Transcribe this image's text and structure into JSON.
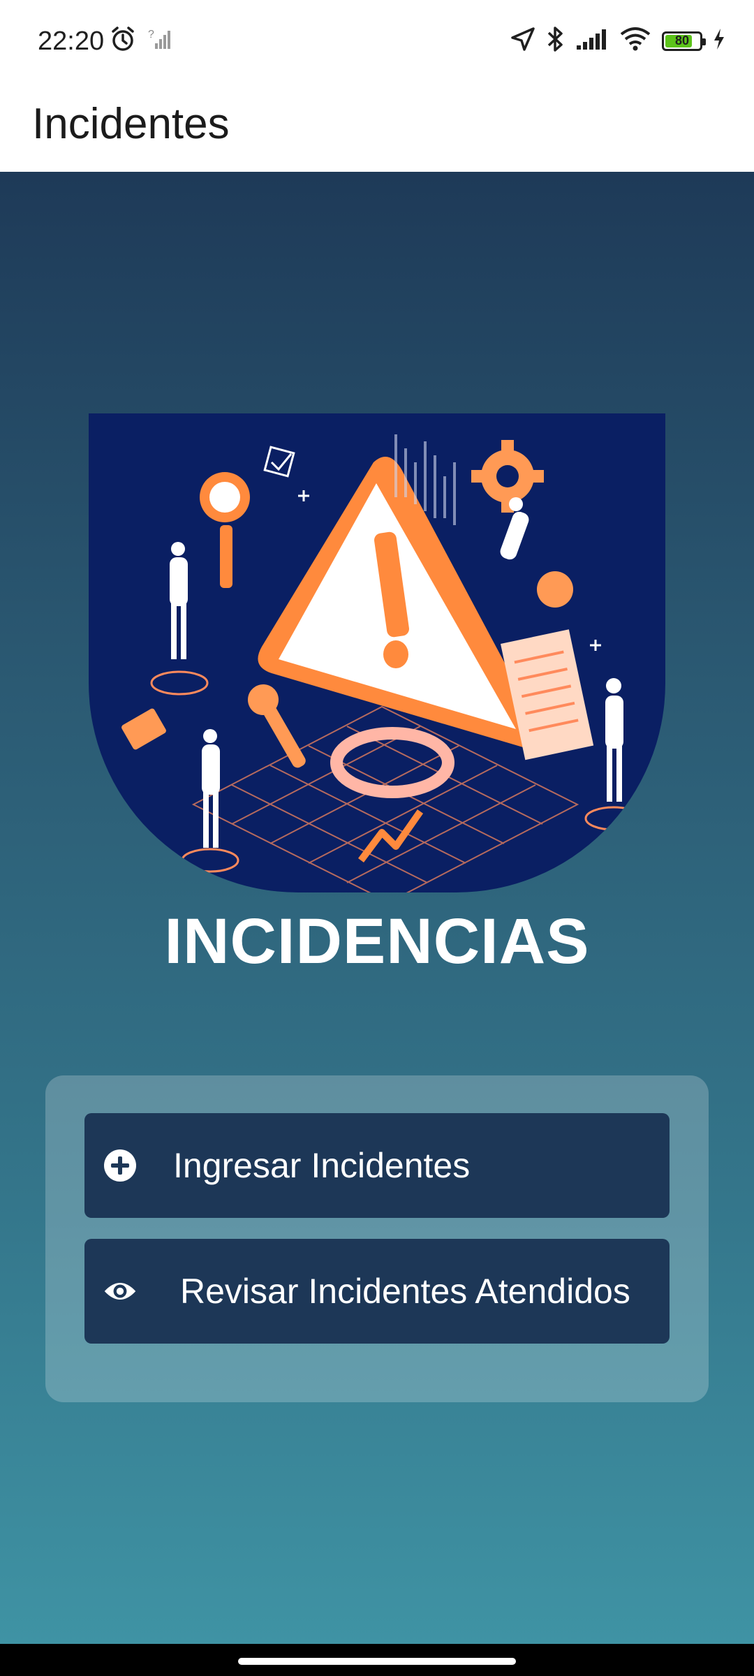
{
  "status_bar": {
    "time": "22:20",
    "battery_level": "80",
    "battery_percent": 80,
    "icons": [
      "alarm-icon",
      "no-signal-icon",
      "location-icon",
      "bluetooth-icon",
      "cellular-signal-icon",
      "wifi-icon",
      "battery-icon",
      "charging-icon"
    ]
  },
  "app_bar": {
    "title": "Incidentes"
  },
  "main": {
    "heading": "INCIDENCIAS",
    "hero_image": "incident-warning-illustration",
    "actions": [
      {
        "label": "Ingresar Incidentes",
        "icon": "plus-circle-icon"
      },
      {
        "label": "Revisar Incidentes Atendidos",
        "icon": "eye-icon"
      }
    ]
  },
  "colors": {
    "gradient_top": "#1e3a58",
    "gradient_bottom": "#3f93a4",
    "button_bg": "#1d3757",
    "hero_bg": "#0a1f63",
    "accent_orange": "#ff8a3d",
    "battery_green": "#5cc31a"
  }
}
